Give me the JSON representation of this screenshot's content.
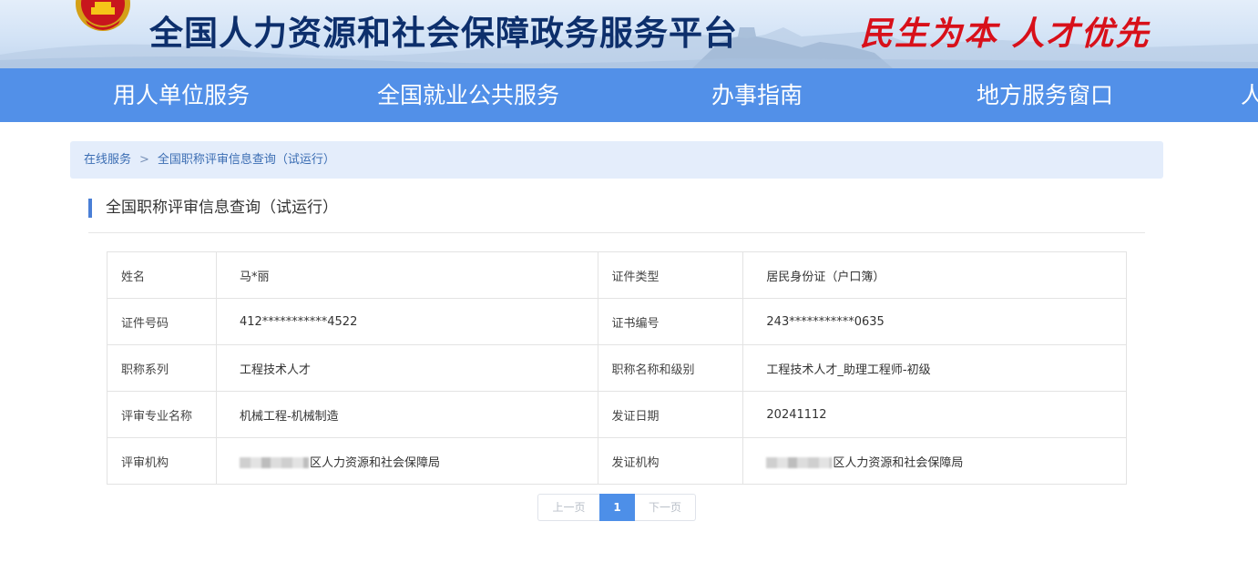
{
  "header": {
    "site_title": "全国人力资源和社会保障政务服务平台",
    "slogan": "民生为本 人才优先"
  },
  "nav": {
    "items": [
      "用人单位服务",
      "全国就业公共服务",
      "办事指南",
      "地方服务窗口",
      "人"
    ]
  },
  "breadcrumb": {
    "items": [
      "在线服务",
      "全国职称评审信息查询（试运行）"
    ],
    "separator": ">"
  },
  "section": {
    "title": "全国职称评审信息查询（试运行）"
  },
  "record": {
    "name_label": "姓名",
    "name": "马*丽",
    "id_type_label": "证件类型",
    "id_type": "居民身份证（户口簿）",
    "id_no_label": "证件号码",
    "id_no": "412***********4522",
    "cert_no_label": "证书编号",
    "cert_no": "243***********0635",
    "series_label": "职称系列",
    "series": "工程技术人才",
    "title_level_label": "职称名称和级别",
    "title_level": "工程技术人才_助理工程师-初级",
    "major_label": "评审专业名称",
    "major": "机械工程-机械制造",
    "issue_date_label": "发证日期",
    "issue_date": "20241112",
    "review_org_label": "评审机构",
    "review_org": "区人力资源和社会保障局",
    "issue_org_label": "发证机构",
    "issue_org": "区人力资源和社会保障局"
  },
  "pagination": {
    "prev": "上一页",
    "current": "1",
    "next": "下一页"
  },
  "colors": {
    "nav_bg": "#5290e8",
    "title_text": "#0d2f6c",
    "slogan": "#d8101a",
    "breadcrumb_bg": "#e4edfb",
    "accent": "#4d8fe8"
  }
}
